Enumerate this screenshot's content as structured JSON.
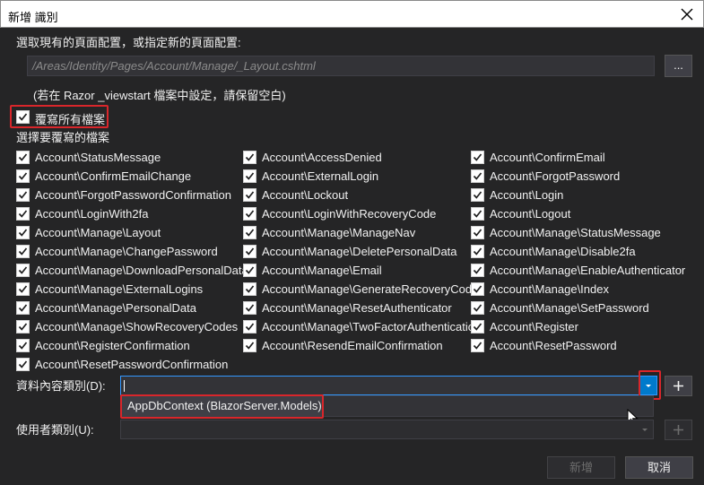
{
  "dialog": {
    "title": "新增 識別",
    "layout_prompt": "選取現有的頁面配置，或指定新的頁面配置:",
    "layout_value": "/Areas/Identity/Pages/Account/Manage/_Layout.cshtml",
    "browse_label": "...",
    "layout_hint": "(若在 Razor _viewstart 檔案中設定，請保留空白)",
    "override_all_label": "覆寫所有檔案",
    "select_files_label": "選擇要覆寫的檔案",
    "files": [
      "Account\\StatusMessage",
      "Account\\AccessDenied",
      "Account\\ConfirmEmail",
      "Account\\ConfirmEmailChange",
      "Account\\ExternalLogin",
      "Account\\ForgotPassword",
      "Account\\ForgotPasswordConfirmation",
      "Account\\Lockout",
      "Account\\Login",
      "Account\\LoginWith2fa",
      "Account\\LoginWithRecoveryCode",
      "Account\\Logout",
      "Account\\Manage\\Layout",
      "Account\\Manage\\ManageNav",
      "Account\\Manage\\StatusMessage",
      "Account\\Manage\\ChangePassword",
      "Account\\Manage\\DeletePersonalData",
      "Account\\Manage\\Disable2fa",
      "Account\\Manage\\DownloadPersonalData",
      "Account\\Manage\\Email",
      "Account\\Manage\\EnableAuthenticator",
      "Account\\Manage\\ExternalLogins",
      "Account\\Manage\\GenerateRecoveryCodes",
      "Account\\Manage\\Index",
      "Account\\Manage\\PersonalData",
      "Account\\Manage\\ResetAuthenticator",
      "Account\\Manage\\SetPassword",
      "Account\\Manage\\ShowRecoveryCodes",
      "Account\\Manage\\TwoFactorAuthentication",
      "Account\\Register",
      "Account\\RegisterConfirmation",
      "Account\\ResendEmailConfirmation",
      "Account\\ResetPassword",
      "Account\\ResetPasswordConfirmation"
    ],
    "data_context_label": "資料內容類別(D):",
    "data_context_option": "AppDbContext (BlazorServer.Models)",
    "add_label": "+",
    "user_class_label": "使用者類別(U):",
    "add_button": "新增",
    "cancel_button": "取消"
  },
  "colors": {
    "accent": "#007acc",
    "highlight": "#d9262b",
    "background": "#252526"
  },
  "icons": [
    "close-icon",
    "checkmark-icon",
    "chevron-down-icon",
    "mouse-cursor-icon"
  ]
}
